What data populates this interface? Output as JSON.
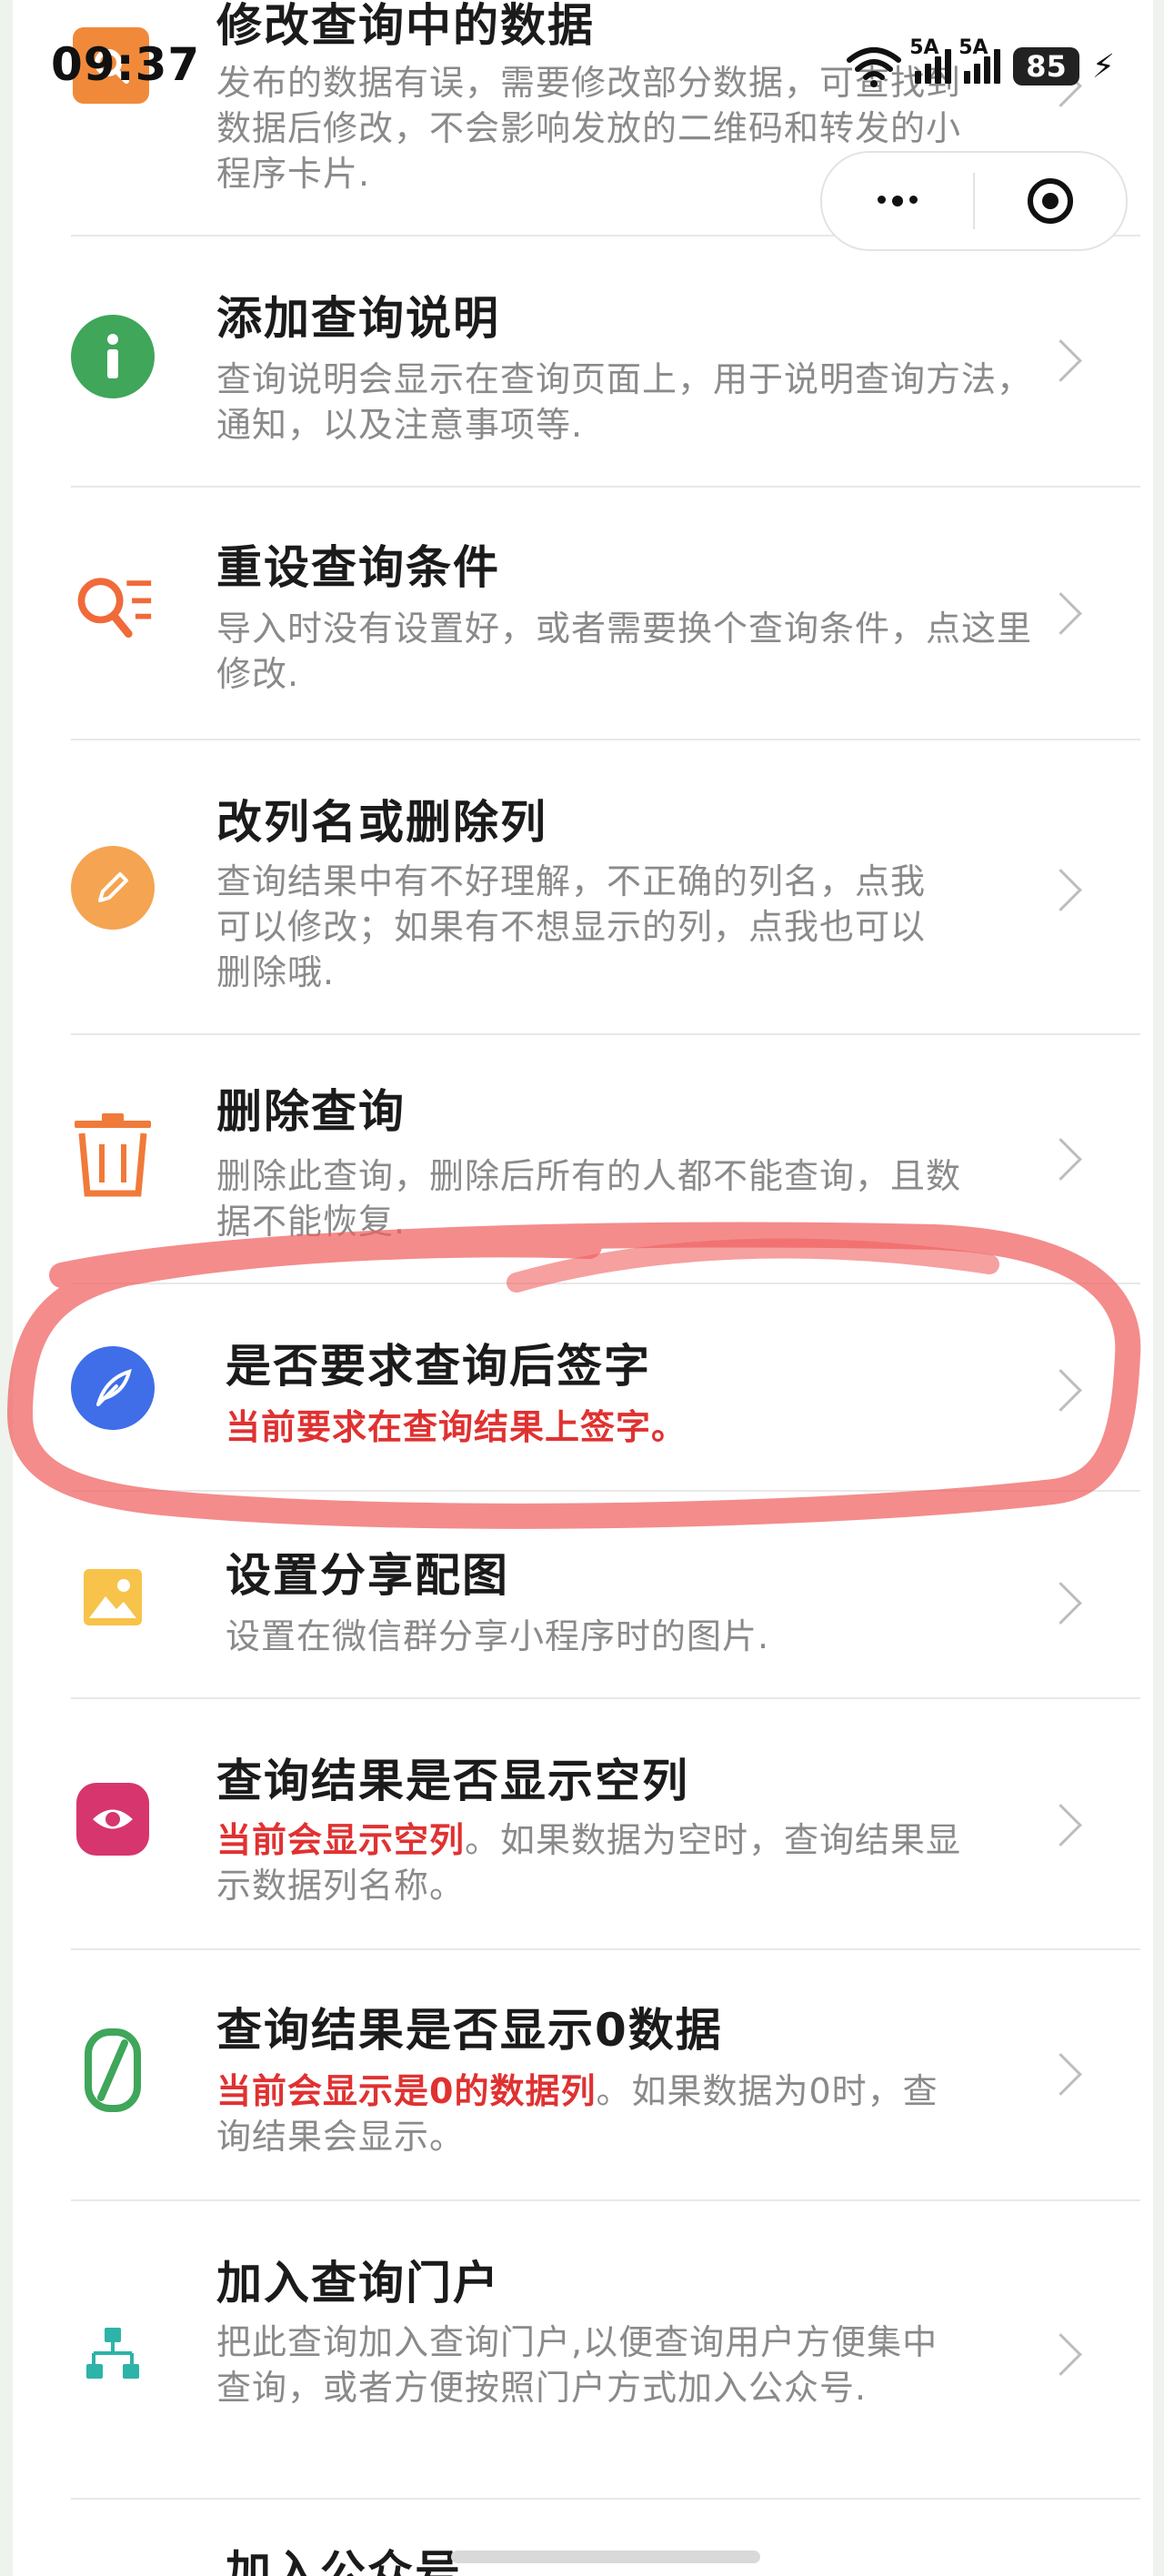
{
  "status_bar": {
    "time": "09:37",
    "network1": "5A",
    "network2": "5A",
    "battery": "85"
  },
  "capsule": {
    "more_icon": "more-dots-icon",
    "close_icon": "target-circle-icon"
  },
  "items": [
    {
      "title": "修改查询中的数据",
      "desc": "发布的数据有误，需要修改部分数据，可查找到数据后修改，不会影响发放的二维码和转发的小程序卡片.",
      "icon": "search-icon",
      "color": "#f08a3a"
    },
    {
      "title": "添加查询说明",
      "desc": "查询说明会显示在查询页面上，用于说明查询方法，通知，以及注意事项等.",
      "icon": "info-icon",
      "color": "#3fa65a"
    },
    {
      "title": "重设查询条件",
      "desc": "导入时没有设置好，或者需要换个查询条件，点这里修改.",
      "icon": "search-filter-icon",
      "color": "#f06a3a"
    },
    {
      "title": "改列名或删除列",
      "desc": "查询结果中有不好理解，不正确的列名，点我可以修改；如果有不想显示的列，点我也可以删除哦.",
      "icon": "pencil-icon",
      "color": "#f5a452"
    },
    {
      "title": "删除查询",
      "desc": "删除此查询，删除后所有的人都不能查询，且数据不能恢复.",
      "icon": "trash-icon",
      "color": "#f07a3a"
    },
    {
      "title": "是否要求查询后签字",
      "desc_highlight": "当前要求在查询结果上签字。",
      "desc": "",
      "icon": "feather-icon",
      "color": "#3f6ee8"
    },
    {
      "title": "设置分享配图",
      "desc": "设置在微信群分享小程序时的图片.",
      "icon": "image-icon",
      "color": "#f7c34a"
    },
    {
      "title": "查询结果是否显示空列",
      "desc_highlight": "当前会显示空列",
      "desc": "。如果数据为空时，查询结果显示数据列名称。",
      "icon": "eye-icon",
      "color": "#d6356e"
    },
    {
      "title": "查询结果是否显示0数据",
      "desc_highlight": "当前会显示是0的数据列",
      "desc": "。如果数据为0时，查询结果会显示。",
      "icon": "zero-icon",
      "color": "#3fa65a"
    },
    {
      "title": "加入查询门户",
      "desc": "把此查询加入查询门户,以便查询用户方便集中查询，或者方便按照门户方式加入公众号.",
      "icon": "sitemap-icon",
      "color": "#2db3a8"
    },
    {
      "title": "加入公众号",
      "desc": "",
      "icon": "publish-icon",
      "color": "#2d8ae0"
    }
  ],
  "annotation": {
    "color": "#f06060",
    "type": "hand-drawn-circle"
  }
}
